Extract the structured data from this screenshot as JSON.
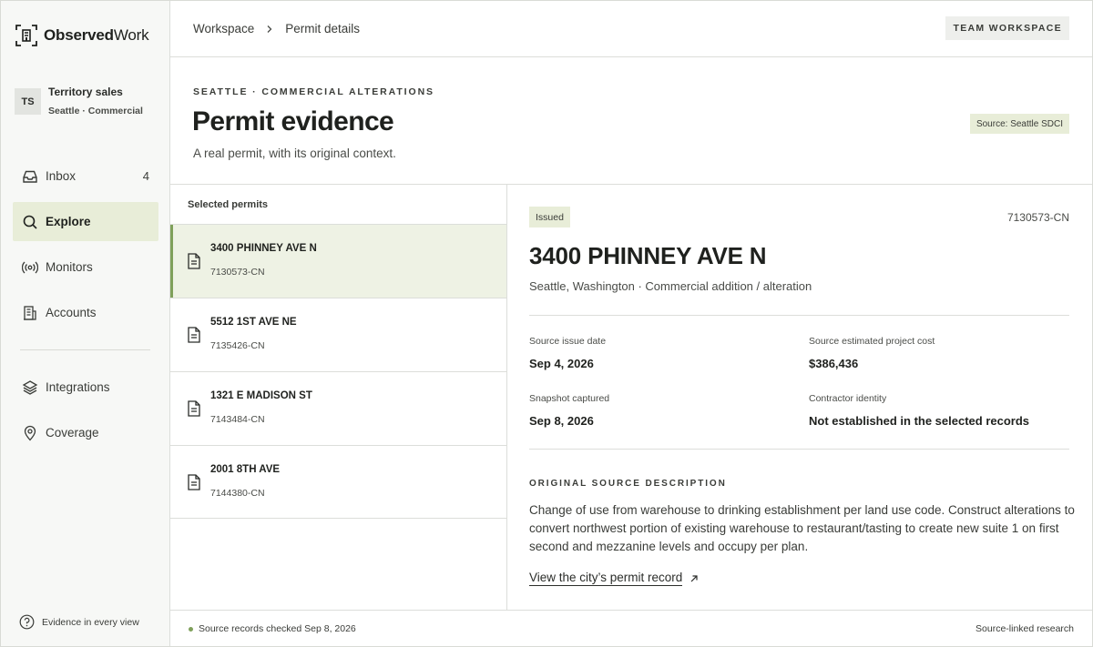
{
  "brand": {
    "name_bold": "Observed",
    "name_light": "Work"
  },
  "account": {
    "initials": "TS",
    "name": "Territory sales",
    "sub": "Seattle · Commercial"
  },
  "nav": {
    "primary": [
      {
        "label": "Inbox",
        "icon": "inbox-icon",
        "count": "4"
      },
      {
        "label": "Explore",
        "icon": "search-icon",
        "active": true
      },
      {
        "label": "Monitors",
        "icon": "broadcast-icon"
      },
      {
        "label": "Accounts",
        "icon": "building-icon"
      }
    ],
    "secondary": [
      {
        "label": "Integrations",
        "icon": "layers-icon"
      },
      {
        "label": "Coverage",
        "icon": "map-pin-icon"
      }
    ]
  },
  "sidebar_footer": "Evidence in every view",
  "breadcrumb": {
    "root": "Workspace",
    "current": "Permit details"
  },
  "team_button": "TEAM WORKSPACE",
  "hero": {
    "eyebrow": "SEATTLE · COMMERCIAL ALTERATIONS",
    "title": "Permit evidence",
    "subtitle": "A real permit, with its original context.",
    "source_badge": "Source: Seattle SDCI"
  },
  "list": {
    "header": "Selected permits",
    "permits": [
      {
        "address": "3400 PHINNEY AVE N",
        "id": "7130573-CN",
        "active": true
      },
      {
        "address": "5512 1ST AVE NE",
        "id": "7135426-CN"
      },
      {
        "address": "1321 E MADISON ST",
        "id": "7143484-CN"
      },
      {
        "address": "2001 8TH AVE",
        "id": "7144380-CN"
      }
    ]
  },
  "detail": {
    "status": "Issued",
    "id": "7130573-CN",
    "title": "3400 PHINNEY AVE N",
    "subtitle": "Seattle, Washington · Commercial addition / alteration",
    "fields": {
      "issue_date_label": "Source issue date",
      "issue_date": "Sep 4, 2026",
      "cost_label": "Source estimated project cost",
      "cost": "$386,436",
      "snapshot_label": "Snapshot captured",
      "snapshot": "Sep 8, 2026",
      "contractor_label": "Contractor identity",
      "contractor": "Not established in the selected records"
    },
    "section_label": "ORIGINAL SOURCE DESCRIPTION",
    "description": "Change of use from warehouse to drinking establishment per land use code. Construct alterations to convert northwest portion of existing warehouse to restaurant/tasting to create new suite 1 on first second and mezzanine levels and occupy per plan.",
    "link": "View the city’s permit record"
  },
  "footer": {
    "status": "Source records checked Sep 8, 2026",
    "right": "Source-linked research"
  },
  "colors": {
    "accent": "#7fa05a",
    "accent_bg": "#e8edd8",
    "text": "#1f211e"
  }
}
